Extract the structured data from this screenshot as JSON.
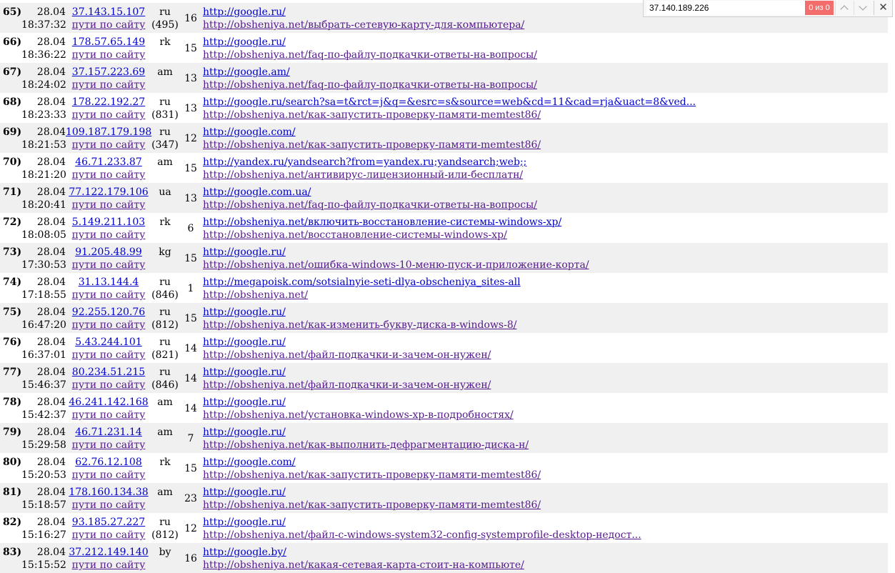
{
  "find_bar": {
    "query": "37.140.189.226",
    "count": "0 из 0",
    "close_glyph": "✕"
  },
  "rows": [
    {
      "num": "65)",
      "date": "28.04",
      "time": "18:37:32",
      "ip": "37.143.15.107",
      "path": "пути по сайту",
      "country": "ru",
      "extra": "(495)",
      "count": "16",
      "ref": "http://google.ru/",
      "page": "http://obsheniya.net/выбрать-сетевую-карту-для-компьютера/"
    },
    {
      "num": "66)",
      "date": "28.04",
      "time": "18:36:22",
      "ip": "178.57.65.149",
      "path": "пути по сайту",
      "country": "rk",
      "extra": "",
      "count": "15",
      "ref": "http://google.ru/",
      "page": "http://obsheniya.net/faq-по-файлу-подкачки-ответы-на-вопросы/"
    },
    {
      "num": "67)",
      "date": "28.04",
      "time": "18:24:02",
      "ip": "37.157.223.69",
      "path": "пути по сайту",
      "country": "am",
      "extra": "",
      "count": "13",
      "ref": "http://google.am/",
      "page": "http://obsheniya.net/faq-по-файлу-подкачки-ответы-на-вопросы/"
    },
    {
      "num": "68)",
      "date": "28.04",
      "time": "18:23:33",
      "ip": "178.22.192.27",
      "path": "пути по сайту",
      "country": "ru",
      "extra": "(831)",
      "count": "13",
      "ref": "http://google.ru/search?sa=t&rct=j&q=&esrc=s&source=web&cd=11&cad=rja&uact=8&ved...",
      "page": "http://obsheniya.net/как-запустить-проверку-памяти-memtest86/"
    },
    {
      "num": "69)",
      "date": "28.04",
      "time": "18:21:53",
      "ip": "109.187.179.198",
      "path": "пути по сайту",
      "country": "ru",
      "extra": "(347)",
      "count": "12",
      "ref": "http://google.com/",
      "page": "http://obsheniya.net/как-запустить-проверку-памяти-memtest86/"
    },
    {
      "num": "70)",
      "date": "28.04",
      "time": "18:21:20",
      "ip": "46.71.233.87",
      "path": "пути по сайту",
      "country": "am",
      "extra": "",
      "count": "15",
      "ref": "http://yandex.ru/yandsearch?from=yandex.ru;yandsearch;web;;",
      "page": "http://obsheniya.net/антивирус-лицензионный-или-бесплатн/"
    },
    {
      "num": "71)",
      "date": "28.04",
      "time": "18:20:41",
      "ip": "77.122.179.106",
      "path": "пути по сайту",
      "country": "ua",
      "extra": "",
      "count": "13",
      "ref": "http://google.com.ua/",
      "page": "http://obsheniya.net/faq-по-файлу-подкачки-ответы-на-вопросы/"
    },
    {
      "num": "72)",
      "date": "28.04",
      "time": "18:08:05",
      "ip": "5.149.211.103",
      "path": "пути по сайту",
      "country": "rk",
      "extra": "",
      "count": "6",
      "ref": "http://obsheniya.net/включить-восстановление-системы-windows-xp/",
      "page": "http://obsheniya.net/восстановление-системы-windows-xp/"
    },
    {
      "num": "73)",
      "date": "28.04",
      "time": "17:30:53",
      "ip": "91.205.48.99",
      "path": "пути по сайту",
      "country": "kg",
      "extra": "",
      "count": "15",
      "ref": "http://google.ru/",
      "page": "http://obsheniya.net/ошибка-windows-10-меню-пуск-и-приложение-корта/"
    },
    {
      "num": "74)",
      "date": "28.04",
      "time": "17:18:55",
      "ip": "31.13.144.4",
      "path": "пути по сайту",
      "country": "ru",
      "extra": "(846)",
      "count": "1",
      "ref": "http://megapoisk.com/sotsialnyie-seti-dlya-obscheniya_sites-all",
      "page": "http://obsheniya.net/"
    },
    {
      "num": "75)",
      "date": "28.04",
      "time": "16:47:20",
      "ip": "92.255.120.76",
      "path": "пути по сайту",
      "country": "ru",
      "extra": "(812)",
      "count": "15",
      "ref": "http://google.ru/",
      "page": "http://obsheniya.net/как-изменить-букву-диска-в-windows-8/"
    },
    {
      "num": "76)",
      "date": "28.04",
      "time": "16:37:01",
      "ip": "5.43.244.101",
      "path": "пути по сайту",
      "country": "ru",
      "extra": "(821)",
      "count": "14",
      "ref": "http://google.ru/",
      "page": "http://obsheniya.net/файл-подкачки-и-зачем-он-нужен/"
    },
    {
      "num": "77)",
      "date": "28.04",
      "time": "15:46:37",
      "ip": "80.234.51.215",
      "path": "пути по сайту",
      "country": "ru",
      "extra": "(846)",
      "count": "14",
      "ref": "http://google.ru/",
      "page": "http://obsheniya.net/файл-подкачки-и-зачем-он-нужен/"
    },
    {
      "num": "78)",
      "date": "28.04",
      "time": "15:42:37",
      "ip": "46.241.142.168",
      "path": "пути по сайту",
      "country": "am",
      "extra": "",
      "count": "14",
      "ref": "http://google.ru/",
      "page": "http://obsheniya.net/установка-windows-xp-в-подробностях/"
    },
    {
      "num": "79)",
      "date": "28.04",
      "time": "15:29:58",
      "ip": "46.71.231.14",
      "path": "пути по сайту",
      "country": "am",
      "extra": "",
      "count": "7",
      "ref": "http://google.ru/",
      "page": "http://obsheniya.net/как-выполнить-дефрагментацию-диска-н/"
    },
    {
      "num": "80)",
      "date": "28.04",
      "time": "15:20:53",
      "ip": "62.76.12.108",
      "path": "пути по сайту",
      "country": "rk",
      "extra": "",
      "count": "15",
      "ref": "http://google.com/",
      "page": "http://obsheniya.net/как-запустить-проверку-памяти-memtest86/"
    },
    {
      "num": "81)",
      "date": "28.04",
      "time": "15:18:57",
      "ip": "178.160.134.38",
      "path": "пути по сайту",
      "country": "am",
      "extra": "",
      "count": "23",
      "ref": "http://google.ru/",
      "page": "http://obsheniya.net/как-запустить-проверку-памяти-memtest86/"
    },
    {
      "num": "82)",
      "date": "28.04",
      "time": "15:16:27",
      "ip": "93.185.27.227",
      "path": "пути по сайту",
      "country": "ru",
      "extra": "(812)",
      "count": "12",
      "ref": "http://google.ru/",
      "page": "http://obsheniya.net/файл-с-windows-system32-config-systemprofile-desktop-недост..."
    },
    {
      "num": "83)",
      "date": "28.04",
      "time": "15:15:52",
      "ip": "37.212.149.140",
      "path": "пути по сайту",
      "country": "by",
      "extra": "",
      "count": "16",
      "ref": "http://google.by/",
      "page": "http://obsheniya.net/какая-сетевая-карта-стоит-на-компьюте/"
    }
  ]
}
